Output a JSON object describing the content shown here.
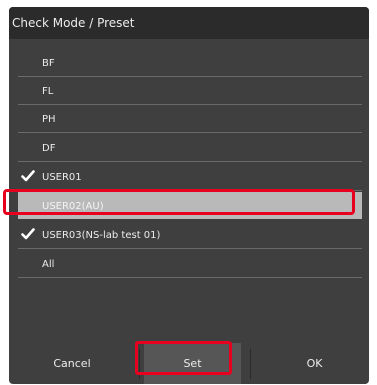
{
  "dialog": {
    "title": "Check Mode / Preset"
  },
  "list": {
    "items": [
      {
        "label": "BF",
        "checked": false,
        "selected": false
      },
      {
        "label": "FL",
        "checked": false,
        "selected": false
      },
      {
        "label": "PH",
        "checked": false,
        "selected": false
      },
      {
        "label": "DF",
        "checked": false,
        "selected": false
      },
      {
        "label": "USER01",
        "checked": true,
        "selected": false
      },
      {
        "label": "USER02(AU)",
        "checked": false,
        "selected": true
      },
      {
        "label": "USER03(NS-lab test 01)",
        "checked": true,
        "selected": false
      },
      {
        "label": "All",
        "checked": false,
        "selected": false
      }
    ]
  },
  "footer": {
    "cancel_label": "Cancel",
    "set_label": "Set",
    "ok_label": "OK"
  },
  "colors": {
    "dialog_bg": "#3f3f3f",
    "title_bg": "#2b2b2b",
    "selected_bg": "#b9b9b9",
    "highlight_red": "#e8001f"
  },
  "icons": {
    "check": "checkmark-icon"
  }
}
